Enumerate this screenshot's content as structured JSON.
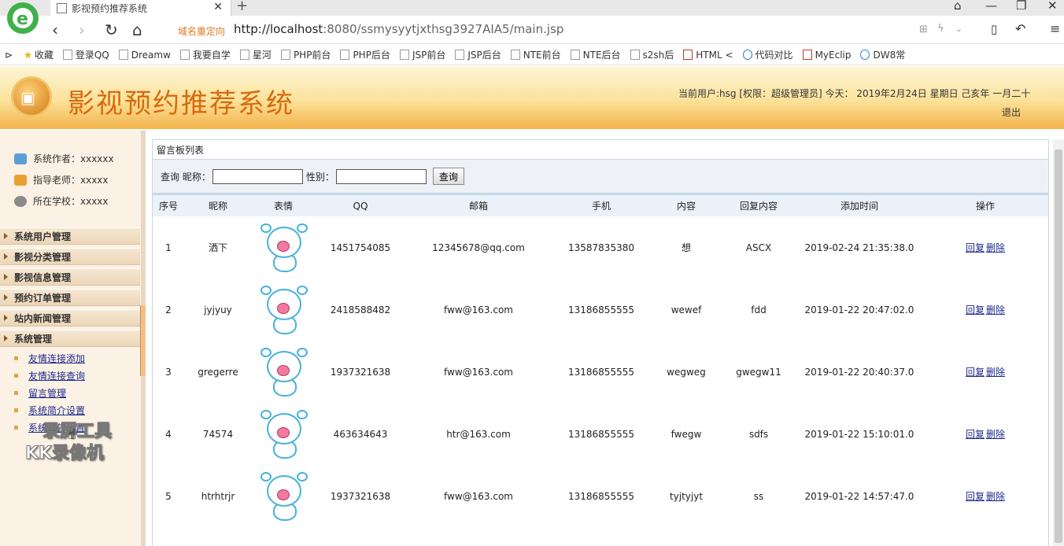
{
  "browser": {
    "tab_title": "影视预约推荐系统",
    "redirect_label": "域名重定向",
    "url_host": "http://localhost",
    "url_rest": ":8080/ssmysyytjxthsg3927AIA5/main.jsp",
    "bookmarks": [
      "收藏",
      "登录QQ",
      "Dreamw",
      "我要自学",
      "星河",
      "PHP前台",
      "PHP后台",
      "JSP前台",
      "JSP后台",
      "NTE前台",
      "NTE后台",
      "s2sh后",
      "HTML <",
      "代码对比",
      "MyEclip",
      "DW8常"
    ]
  },
  "header": {
    "system_title": "影视预约推荐系统",
    "user_info": "当前用户:hsg [权限：超级管理员] 今天： 2019年2月24日 星期日 己亥年 一月二十",
    "logout_label": "退出"
  },
  "sidebar": {
    "info": [
      {
        "label": "系统作者：xxxxxx",
        "color": "#5aa0d8"
      },
      {
        "label": "指导老师：xxxxx",
        "color": "#e8a030"
      },
      {
        "label": "所在学校：xxxxx",
        "color": "#8a8a8a"
      }
    ],
    "menus": [
      "系统用户管理",
      "影视分类管理",
      "影视信息管理",
      "预约订单管理",
      "站内新闻管理",
      "系统管理"
    ],
    "submenus": [
      "友情连接添加",
      "友情连接查询",
      "留言管理",
      "系统简介设置",
      "系统公告设置"
    ]
  },
  "watermark": {
    "line1": "录屏工具",
    "line2": "KK录像机"
  },
  "panel": {
    "title": "留言板列表",
    "search_prefix": "查询 昵称：",
    "gender_label": "性别：",
    "search_button": "查询"
  },
  "table": {
    "columns": [
      "序号",
      "昵称",
      "表情",
      "QQ",
      "邮箱",
      "手机",
      "内容",
      "回复内容",
      "添加时间",
      "操作"
    ],
    "reply_label": "回复",
    "delete_label": "删除",
    "rows": [
      {
        "id": "1",
        "nickname": "洒下",
        "qq": "1451754085",
        "email": "12345678@qq.com",
        "phone": "13587835380",
        "content": "想",
        "reply": "ASCX",
        "time": "2019-02-24 21:35:38.0"
      },
      {
        "id": "2",
        "nickname": "jyjyuy",
        "qq": "2418588482",
        "email": "fww@163.com",
        "phone": "13186855555",
        "content": "wewef",
        "reply": "fdd",
        "time": "2019-01-22 20:47:02.0"
      },
      {
        "id": "3",
        "nickname": "gregerre",
        "qq": "1937321638",
        "email": "fww@163.com",
        "phone": "13186855555",
        "content": "wegweg",
        "reply": "gwegw11",
        "time": "2019-01-22 20:40:37.0"
      },
      {
        "id": "4",
        "nickname": "74574",
        "qq": "463634643",
        "email": "htr@163.com",
        "phone": "13186855555",
        "content": "fwegw",
        "reply": "sdfs",
        "time": "2019-01-22 15:10:01.0"
      },
      {
        "id": "5",
        "nickname": "htrhtrjr",
        "qq": "1937321638",
        "email": "fww@163.com",
        "phone": "13186855555",
        "content": "tyjtyjyt",
        "reply": "ss",
        "time": "2019-01-22 14:57:47.0"
      }
    ]
  }
}
